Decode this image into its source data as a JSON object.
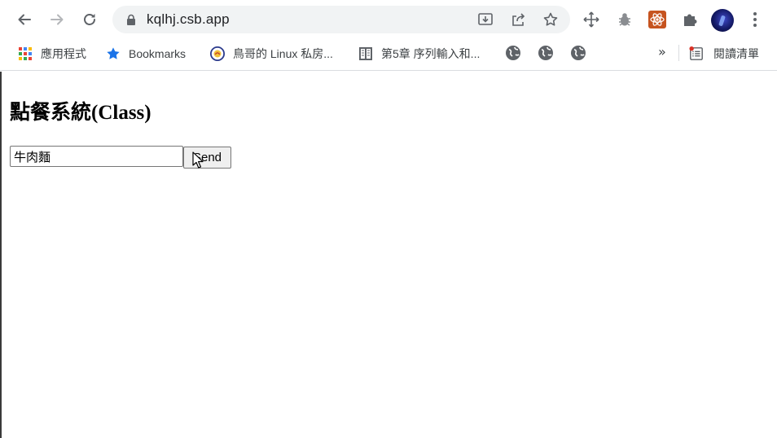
{
  "browser": {
    "url": "kqlhj.csb.app",
    "bookmarks": [
      {
        "label": "應用程式",
        "icon": "apps-grid-icon"
      },
      {
        "label": "Bookmarks",
        "icon": "star-icon"
      },
      {
        "label": "鳥哥的 Linux 私房...",
        "icon": "site-logo-icon"
      },
      {
        "label": "第5章 序列輸入和...",
        "icon": "book-icon"
      }
    ],
    "reading_list": "閱讀清單",
    "overflow": "»"
  },
  "page": {
    "title": "點餐系統(Class)",
    "order_input_value": "牛肉麵",
    "send_label": "Send"
  }
}
